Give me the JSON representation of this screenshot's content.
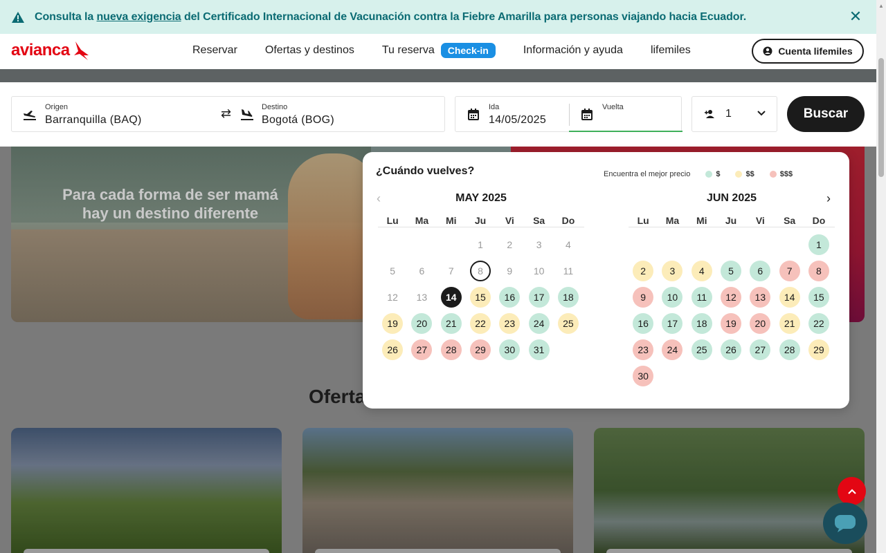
{
  "banner": {
    "text_before": "Consulta la ",
    "link": "nueva exigencia",
    "text_after": " del Certificado Internacional de Vacunación contra la Fiebre Amarilla para personas viajando hacia Ecuador.",
    "close_icon": "close-icon"
  },
  "header": {
    "logo": "avianca",
    "nav": [
      "Reservar",
      "Ofertas y destinos",
      "Tu reserva",
      "Información y ayuda",
      "lifemiles"
    ],
    "checkin": "Check-in",
    "account": "Cuenta lifemiles"
  },
  "search": {
    "origin_label": "Origen",
    "origin_value": "Barranquilla  (BAQ)",
    "dest_label": "Destino",
    "dest_value": "Bogotá  (BOG)",
    "ida_label": "Ida",
    "ida_value": "14/05/2025",
    "vuelta_label": "Vuelta",
    "pax_value": "1",
    "button": "Buscar"
  },
  "hero": {
    "tagline_1": "Para cada forma de ser mamá",
    "tagline_2": "hay un destino diferente"
  },
  "section_title": "Oferta",
  "calendar": {
    "question": "¿Cuándo vuelves?",
    "legend_label": "Encuentra el mejor precio",
    "legend": [
      {
        "label": "$",
        "color": "#c3e8d9"
      },
      {
        "label": "$$",
        "color": "#fcecb9"
      },
      {
        "label": "$$$",
        "color": "#f6c1bb"
      }
    ],
    "dows": [
      "Lu",
      "Ma",
      "Mi",
      "Ju",
      "Vi",
      "Sa",
      "Do"
    ],
    "months": [
      {
        "title": "MAY 2025",
        "offset": 3,
        "days": [
          {
            "d": "1",
            "s": "dis"
          },
          {
            "d": "2",
            "s": "dis"
          },
          {
            "d": "3",
            "s": "dis"
          },
          {
            "d": "4",
            "s": "dis"
          },
          {
            "d": "5",
            "s": "dis"
          },
          {
            "d": "6",
            "s": "dis"
          },
          {
            "d": "7",
            "s": "dis"
          },
          {
            "d": "8",
            "s": "ring"
          },
          {
            "d": "9",
            "s": "dis"
          },
          {
            "d": "10",
            "s": "dis"
          },
          {
            "d": "11",
            "s": "dis"
          },
          {
            "d": "12",
            "s": "dis"
          },
          {
            "d": "13",
            "s": "dis"
          },
          {
            "d": "14",
            "s": "sel"
          },
          {
            "d": "15",
            "s": "y"
          },
          {
            "d": "16",
            "s": "g"
          },
          {
            "d": "17",
            "s": "g"
          },
          {
            "d": "18",
            "s": "g"
          },
          {
            "d": "19",
            "s": "y"
          },
          {
            "d": "20",
            "s": "g"
          },
          {
            "d": "21",
            "s": "g"
          },
          {
            "d": "22",
            "s": "y"
          },
          {
            "d": "23",
            "s": "y"
          },
          {
            "d": "24",
            "s": "g"
          },
          {
            "d": "25",
            "s": "y"
          },
          {
            "d": "26",
            "s": "y"
          },
          {
            "d": "27",
            "s": "r"
          },
          {
            "d": "28",
            "s": "r"
          },
          {
            "d": "29",
            "s": "r"
          },
          {
            "d": "30",
            "s": "g"
          },
          {
            "d": "31",
            "s": "g"
          }
        ]
      },
      {
        "title": "JUN 2025",
        "offset": 6,
        "days": [
          {
            "d": "1",
            "s": "g"
          },
          {
            "d": "2",
            "s": "y"
          },
          {
            "d": "3",
            "s": "y"
          },
          {
            "d": "4",
            "s": "y"
          },
          {
            "d": "5",
            "s": "g"
          },
          {
            "d": "6",
            "s": "g"
          },
          {
            "d": "7",
            "s": "r"
          },
          {
            "d": "8",
            "s": "r"
          },
          {
            "d": "9",
            "s": "r"
          },
          {
            "d": "10",
            "s": "g"
          },
          {
            "d": "11",
            "s": "g"
          },
          {
            "d": "12",
            "s": "r"
          },
          {
            "d": "13",
            "s": "r"
          },
          {
            "d": "14",
            "s": "y"
          },
          {
            "d": "15",
            "s": "g"
          },
          {
            "d": "16",
            "s": "g"
          },
          {
            "d": "17",
            "s": "g"
          },
          {
            "d": "18",
            "s": "g"
          },
          {
            "d": "19",
            "s": "r"
          },
          {
            "d": "20",
            "s": "r"
          },
          {
            "d": "21",
            "s": "y"
          },
          {
            "d": "22",
            "s": "g"
          },
          {
            "d": "23",
            "s": "r"
          },
          {
            "d": "24",
            "s": "r"
          },
          {
            "d": "25",
            "s": "g"
          },
          {
            "d": "26",
            "s": "g"
          },
          {
            "d": "27",
            "s": "g"
          },
          {
            "d": "28",
            "s": "g"
          },
          {
            "d": "29",
            "s": "y"
          },
          {
            "d": "30",
            "s": "r"
          }
        ]
      }
    ]
  },
  "colors": {
    "brand_red": "#e30613",
    "banner_bg": "#d7f1ec",
    "banner_text": "#0b6b73",
    "checkin_blue": "#1a8fe3"
  }
}
